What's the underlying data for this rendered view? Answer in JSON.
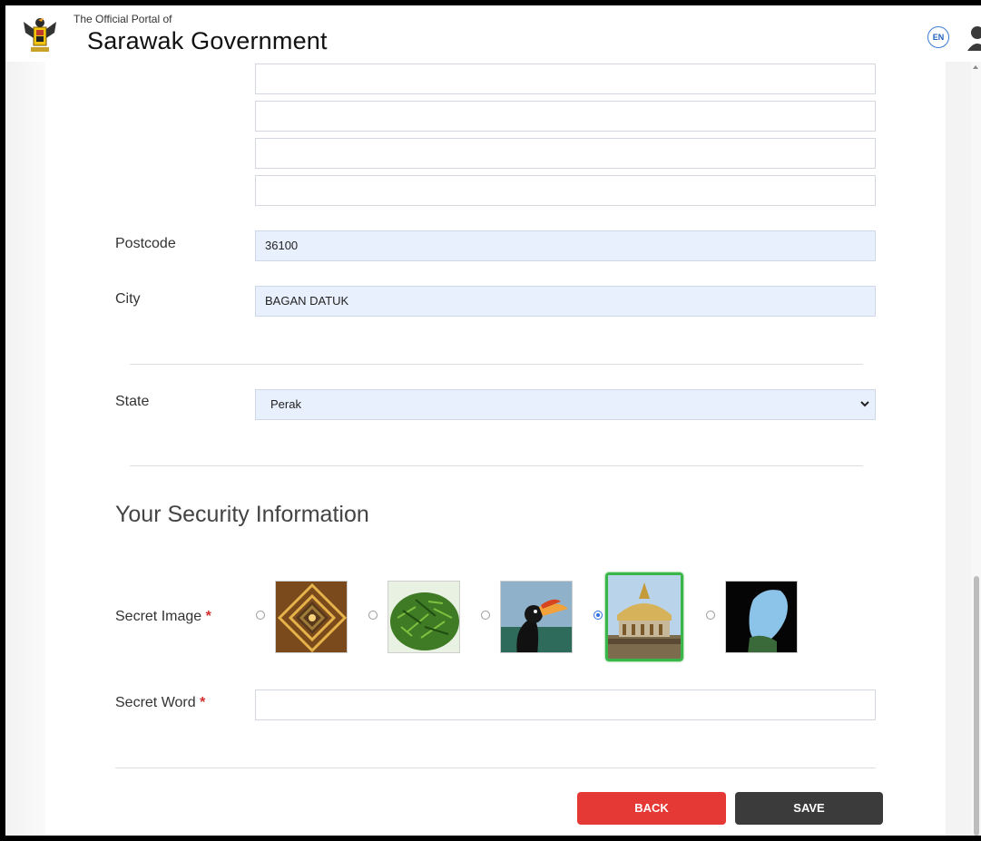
{
  "header": {
    "portal_of": "The Official Portal of",
    "title": "Sarawak Government",
    "language": "EN"
  },
  "address": {
    "lines": [
      "",
      "",
      "",
      ""
    ]
  },
  "form": {
    "postcode_label": "Postcode",
    "postcode_value": "36100",
    "city_label": "City",
    "city_value": "BAGAN DATUK",
    "state_label": "State",
    "state_value": "Perak"
  },
  "security": {
    "title": "Your Security Information",
    "secret_image_label": "Secret Image",
    "secret_word_label": "Secret Word",
    "required_mark": "*",
    "secret_word_value": "",
    "images": [
      {
        "name": "sarawak-motif",
        "selected": false
      },
      {
        "name": "green-fern-dish",
        "selected": false
      },
      {
        "name": "hornbill",
        "selected": false
      },
      {
        "name": "sarawak-building",
        "selected": true
      },
      {
        "name": "cave-opening",
        "selected": false
      }
    ]
  },
  "actions": {
    "back_label": "BACK",
    "save_label": "SAVE"
  },
  "colors": {
    "back_button": "#e53935",
    "save_button": "#3b3b3b",
    "filled_field": "#e8f0fe",
    "selected_border": "#39b54a"
  }
}
